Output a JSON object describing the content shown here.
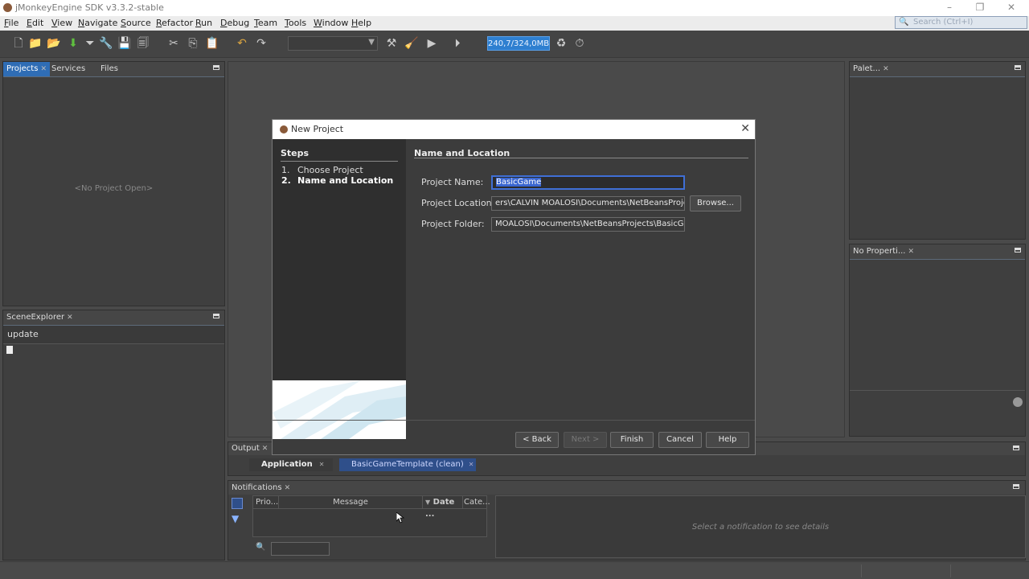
{
  "window": {
    "title": "jMonkeyEngine SDK v3.3.2-stable",
    "controls": {
      "minimize": "–",
      "restore": "❐",
      "close": "✕"
    }
  },
  "menu": [
    {
      "label": "File",
      "mnemonic": "F"
    },
    {
      "label": "Edit",
      "mnemonic": "E"
    },
    {
      "label": "View",
      "mnemonic": "V"
    },
    {
      "label": "Navigate",
      "mnemonic": "N"
    },
    {
      "label": "Source",
      "mnemonic": "S"
    },
    {
      "label": "Refactor",
      "mnemonic": "R"
    },
    {
      "label": "Run",
      "mnemonic": "R"
    },
    {
      "label": "Debug",
      "mnemonic": "D"
    },
    {
      "label": "Team",
      "mnemonic": "T"
    },
    {
      "label": "Tools",
      "mnemonic": "T"
    },
    {
      "label": "Window",
      "mnemonic": "W"
    },
    {
      "label": "Help",
      "mnemonic": "H"
    }
  ],
  "search": {
    "placeholder": "Search (Ctrl+I)"
  },
  "toolbar": {
    "memory_label": "240,7/324,0MB",
    "icons": [
      "new-file-icon",
      "new-project-icon",
      "open-project-icon",
      "download-icon",
      "filter-icon",
      "wrench-icon",
      "save-icon",
      "save-all-icon",
      "cut-icon",
      "copy-icon",
      "paste-icon",
      "undo-icon",
      "redo-icon",
      "build-icon",
      "clean-build-icon",
      "run-icon",
      "debug-icon",
      "gc-icon",
      "profile-icon"
    ]
  },
  "projects_panel": {
    "tabs": [
      "Projects",
      "Services",
      "Files"
    ],
    "empty_text": "<No Project Open>"
  },
  "scene_explorer": {
    "tab": "SceneExplorer",
    "button_label": "update"
  },
  "palette_panel": {
    "tab": "Palet..."
  },
  "properties_panel": {
    "tab": "No Properti..."
  },
  "dialog": {
    "title": "New Project",
    "steps_header": "Steps",
    "steps": [
      {
        "num": "1.",
        "label": "Choose Project"
      },
      {
        "num": "2.",
        "label": "Name and Location"
      }
    ],
    "content_header": "Name and Location",
    "project_name_label": "Project Name:",
    "project_name_value": "BasicGame",
    "project_location_label": "Project Location:",
    "project_location_value": "ers\\CALVIN MOALOSI\\Documents\\NetBeansProjects",
    "project_folder_label": "Project Folder:",
    "project_folder_value": "MOALOSI\\Documents\\NetBeansProjects\\BasicGame",
    "browse_label": "Browse...",
    "back_label": "< Back",
    "next_label": "Next >",
    "finish_label": "Finish",
    "cancel_label": "Cancel",
    "help_label": "Help"
  },
  "output_panel": {
    "tab": "Output",
    "subtabs": [
      "Application",
      "BasicGameTemplate (clean)"
    ]
  },
  "notifications_panel": {
    "tab": "Notifications",
    "columns": [
      "Prio...",
      "Message",
      "Date ...",
      "Cate..."
    ],
    "detail_placeholder": "Select a notification to see details"
  },
  "colors": {
    "accent": "#2f6db5",
    "memory_bar": "#2e7fd0",
    "background": "#4a4a4a"
  }
}
